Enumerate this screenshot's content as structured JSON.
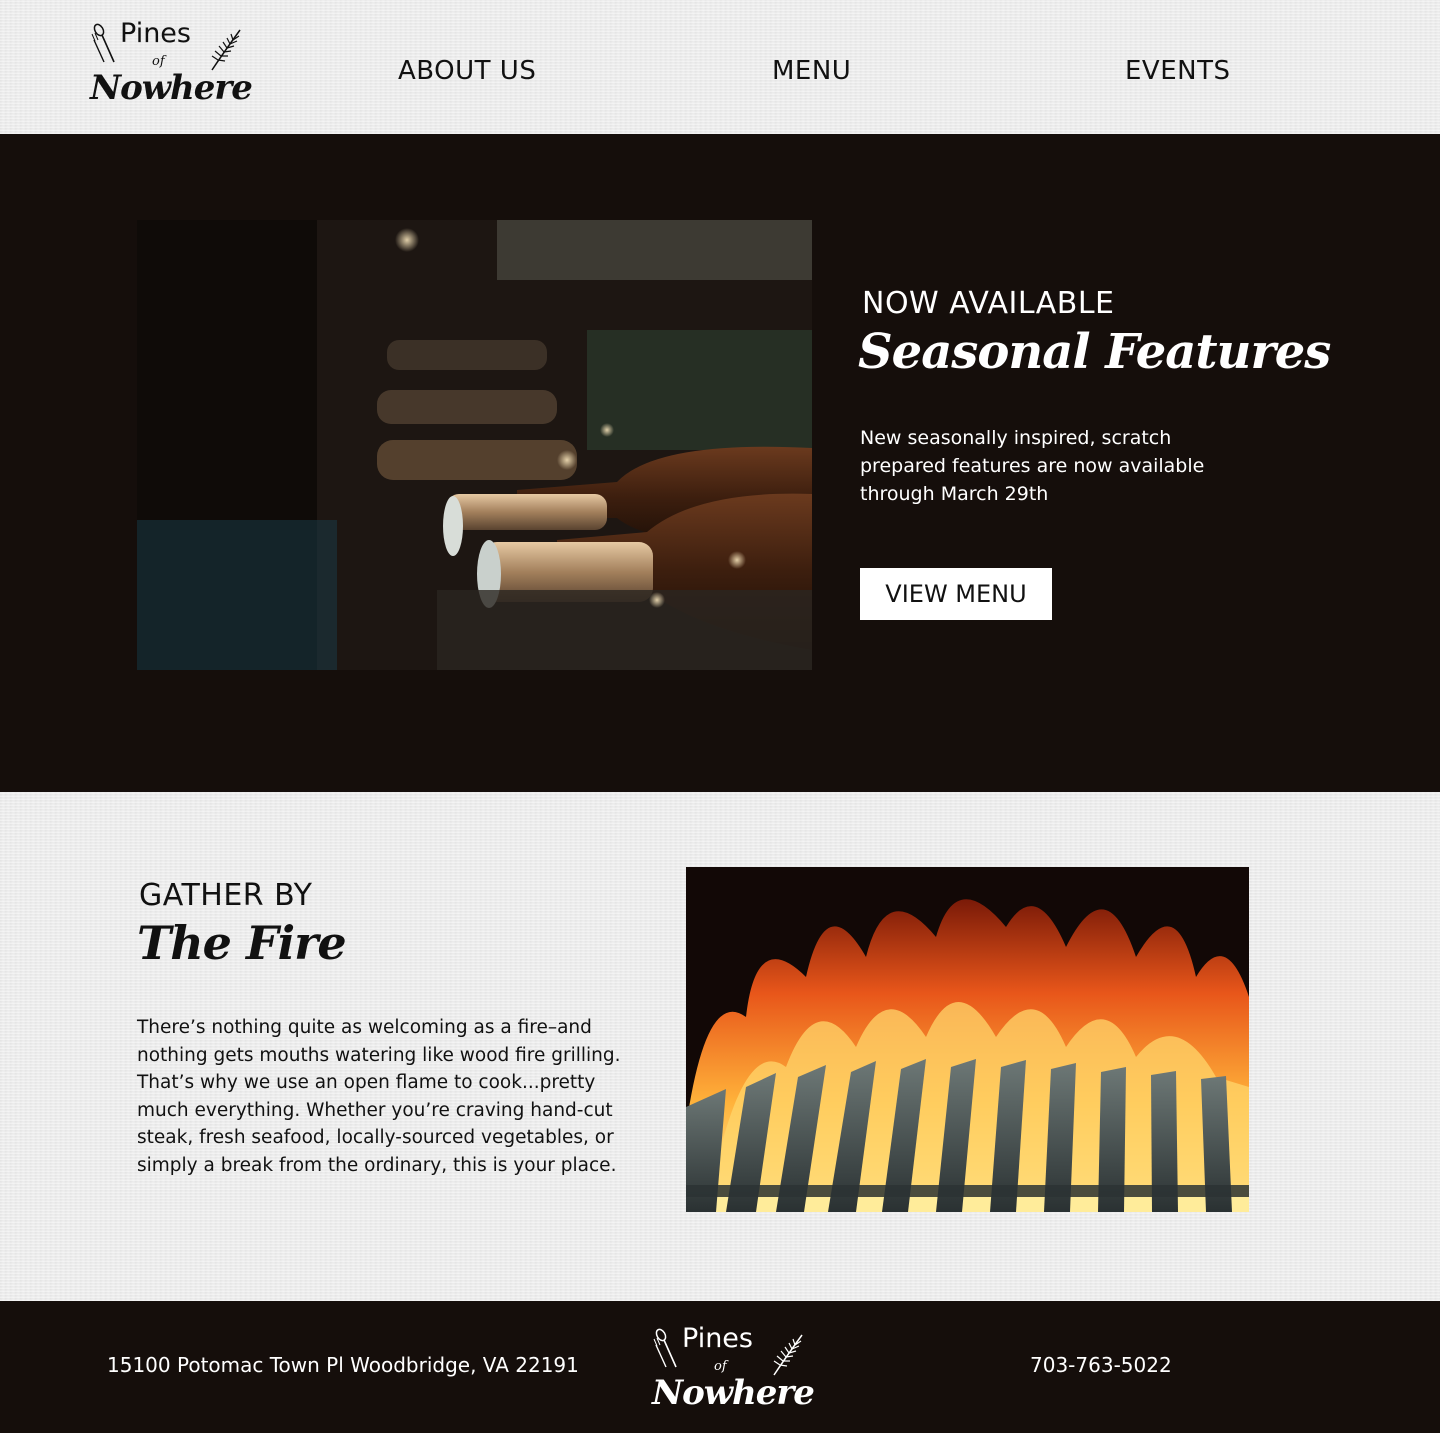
{
  "brand": {
    "logo_line1": "Pines",
    "logo_line2": "of",
    "logo_line3": "Nowhere"
  },
  "nav": {
    "items": [
      {
        "label": "ABOUT US"
      },
      {
        "label": "MENU"
      },
      {
        "label": "EVENTS"
      }
    ]
  },
  "hero": {
    "eyebrow": "NOW AVAILABLE",
    "title": "Seasonal Features",
    "description": "New seasonally inspired, scratch prepared features are now available through March 29th",
    "button_label": "VIEW MENU",
    "image_icon": "wine-bottles-image"
  },
  "fire": {
    "eyebrow": "GATHER BY",
    "title": "The Fire",
    "description": "There’s nothing quite as welcoming as a fire–and nothing gets mouths watering like wood fire grilling. That’s why we use an open flame to cook...pretty much everything. Whether you’re craving hand-cut steak, fresh seafood, locally-sourced vegetables, or simply a break from the ordinary, this is your place.",
    "image_icon": "grill-flames-image"
  },
  "footer": {
    "address": "15100 Potomac Town Pl Woodbridge, VA 22191",
    "phone": "703-763-5022"
  },
  "colors": {
    "dark_bg": "#150e0b",
    "light_bg": "#ebebeb",
    "text_dark": "#111111",
    "text_light": "#ffffff"
  }
}
